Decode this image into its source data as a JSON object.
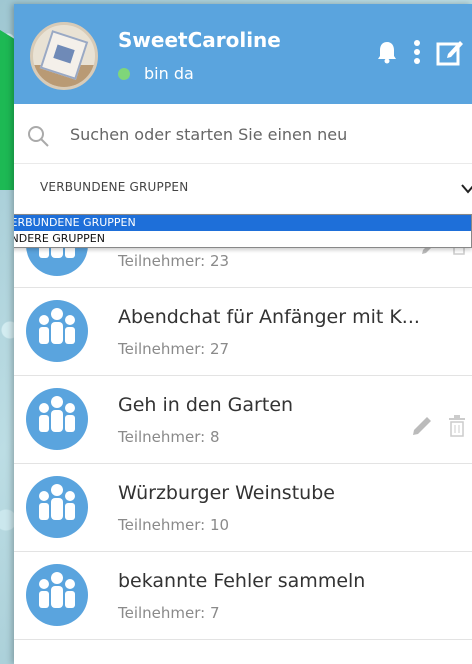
{
  "header": {
    "username": "SweetCaroline",
    "status": "bin da",
    "accent": "#5aa4de"
  },
  "search": {
    "placeholder": "Suchen oder starten Sie einen neu"
  },
  "filter": {
    "selected": "VERBUNDENE GRUPPEN",
    "options": [
      "VERBUNDENE GRUPPEN",
      "ANDERE GRUPPEN"
    ]
  },
  "groups": [
    {
      "name": "",
      "members": "Teilnehmer: 23"
    },
    {
      "name": "Abendchat für Anfänger mit K...",
      "members": "Teilnehmer: 27"
    },
    {
      "name": "Geh in den Garten",
      "members": "Teilnehmer: 8"
    },
    {
      "name": "Würzburger Weinstube",
      "members": "Teilnehmer: 10"
    },
    {
      "name": "bekannte Fehler sammeln",
      "members": "Teilnehmer: 7"
    }
  ],
  "icons": {
    "notifications": "bell-icon",
    "menu": "more-vertical-icon",
    "compose": "edit-icon",
    "search": "search-icon",
    "group": "group-icon",
    "edit": "pencil-icon",
    "delete": "trash-icon"
  }
}
